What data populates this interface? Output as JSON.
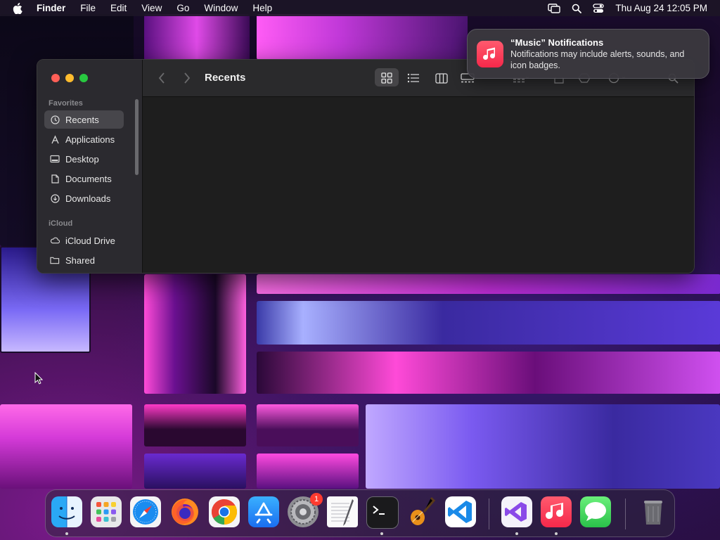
{
  "menubar": {
    "app_name": "Finder",
    "menus": [
      "File",
      "Edit",
      "View",
      "Go",
      "Window",
      "Help"
    ],
    "clock": "Thu Aug 24  12:05 PM",
    "status_icons": [
      "screen-mirroring-icon",
      "spotlight-search-icon",
      "control-center-icon"
    ]
  },
  "finder": {
    "title": "Recents",
    "sidebar": {
      "favorites_label": "Favorites",
      "favorites": [
        {
          "label": "Recents",
          "icon": "clock-icon",
          "active": true
        },
        {
          "label": "Applications",
          "icon": "applications-icon"
        },
        {
          "label": "Desktop",
          "icon": "desktop-icon"
        },
        {
          "label": "Documents",
          "icon": "document-icon"
        },
        {
          "label": "Downloads",
          "icon": "download-icon"
        }
      ],
      "icloud_label": "iCloud",
      "icloud": [
        {
          "label": "iCloud Drive",
          "icon": "cloud-icon"
        },
        {
          "label": "Shared",
          "icon": "shared-folder-icon"
        }
      ]
    },
    "toolbar_icons": [
      "back-chevron-icon",
      "forward-chevron-icon",
      "icon-view-icon",
      "list-view-icon",
      "column-view-icon",
      "gallery-view-icon",
      "group-icon",
      "share-icon",
      "tag-icon",
      "action-icon",
      "search-icon"
    ]
  },
  "notification": {
    "title": "“Music” Notifications",
    "body": "Notifications may include alerts, sounds, and icon badges.",
    "app_icon": "music-note-icon",
    "accent": "#fa2d48"
  },
  "dock": {
    "apps": [
      {
        "name": "Finder",
        "running": true
      },
      {
        "name": "Launchpad"
      },
      {
        "name": "Safari"
      },
      {
        "name": "Firefox"
      },
      {
        "name": "Google Chrome"
      },
      {
        "name": "App Store"
      },
      {
        "name": "System Settings",
        "badge": "1"
      },
      {
        "name": "TextEdit"
      },
      {
        "name": "Terminal",
        "running": true
      },
      {
        "name": "GarageBand"
      },
      {
        "name": "Visual Studio Code"
      },
      {
        "name": "Visual Studio",
        "running": true
      },
      {
        "name": "Music",
        "running": true
      },
      {
        "name": "Messages"
      },
      {
        "name": "Trash"
      }
    ]
  }
}
